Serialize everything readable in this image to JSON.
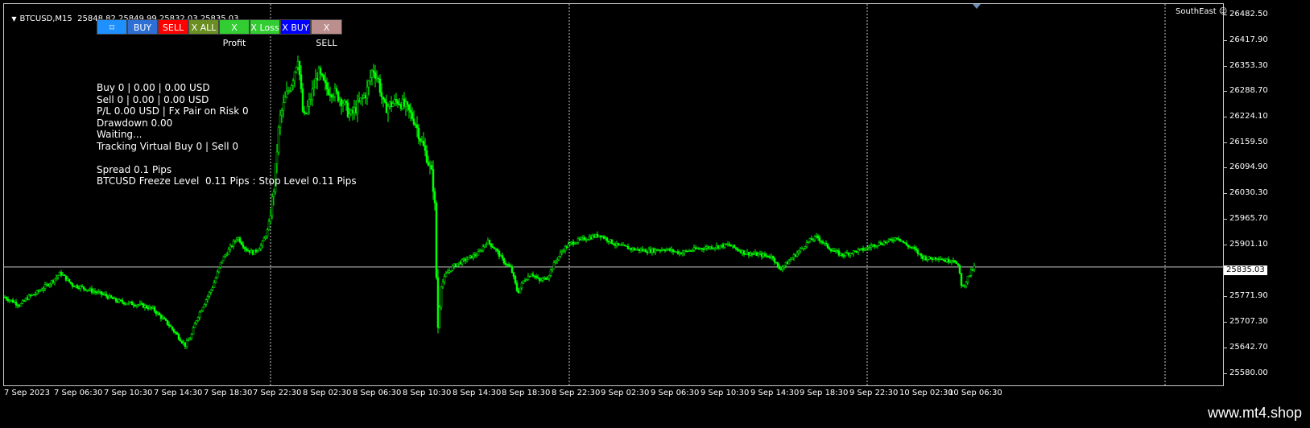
{
  "header": {
    "symbol_text": "BTCUSD,M15  25848.82 25849.99 25832.03 25835.03",
    "corner_label": "SouthEast",
    "corner_icon": "smiley-icon"
  },
  "toolbar": [
    {
      "label": "⌑",
      "color": "#1e90ff",
      "icon": "crosshair-icon"
    },
    {
      "label": "BUY",
      "color": "#2e6fd6"
    },
    {
      "label": "SELL",
      "color": "#ff0000"
    },
    {
      "label": "X ALL",
      "color": "#6b8e23"
    },
    {
      "label": "X Profit",
      "color": "#32cd32"
    },
    {
      "label": "X Loss",
      "color": "#32cd32"
    },
    {
      "label": "X BUY",
      "color": "#0000ff"
    },
    {
      "label": "X SELL",
      "color": "#bc8f8f"
    }
  ],
  "info_panel": {
    "line1": "Buy 0 | 0.00 | 0.00 USD",
    "line2": "Sell 0 | 0.00 | 0.00 USD",
    "line3": "P/L 0.00 USD | Fx Pair on Risk 0",
    "line4": "Drawdown 0.00",
    "line5": "Waiting...",
    "line6": "Tracking Virtual Buy 0 | Sell 0",
    "line7": "Spread 0.1 Pips",
    "line8": "BTCUSD Freeze Level  0.11 Pips : Stop Level 0.11 Pips"
  },
  "price_axis": {
    "labels": [
      "26482.50",
      "26417.90",
      "26353.30",
      "26288.70",
      "26224.10",
      "26159.50",
      "26094.90",
      "26030.30",
      "25965.70",
      "25901.10",
      "25835.03",
      "25771.90",
      "25707.30",
      "25642.70",
      "25580.00"
    ],
    "current_price": "25835.03"
  },
  "time_axis": {
    "labels": [
      "7 Sep 2023",
      "7 Sep 06:30",
      "7 Sep 10:30",
      "7 Sep 14:30",
      "7 Sep 18:30",
      "7 Sep 22:30",
      "8 Sep 02:30",
      "8 Sep 06:30",
      "8 Sep 10:30",
      "8 Sep 14:30",
      "8 Sep 18:30",
      "8 Sep 22:30",
      "9 Sep 02:30",
      "9 Sep 06:30",
      "9 Sep 10:30",
      "9 Sep 14:30",
      "9 Sep 18:30",
      "9 Sep 22:30",
      "10 Sep 02:30",
      "10 Sep 06:30"
    ]
  },
  "chart_data": {
    "type": "candlestick",
    "symbol": "BTCUSD",
    "timeframe": "M15",
    "ylim": [
      25580.0,
      26482.5
    ],
    "candle_color": "#00ff00",
    "background": "#000000",
    "grid": false,
    "current_price": 25835.03,
    "price_path": [
      [
        0,
        25760
      ],
      [
        10,
        25750
      ],
      [
        20,
        25740
      ],
      [
        30,
        25760
      ],
      [
        40,
        25770
      ],
      [
        50,
        25785
      ],
      [
        60,
        25800
      ],
      [
        70,
        25820
      ],
      [
        75,
        25810
      ],
      [
        85,
        25790
      ],
      [
        95,
        25785
      ],
      [
        110,
        25775
      ],
      [
        125,
        25765
      ],
      [
        140,
        25750
      ],
      [
        155,
        25745
      ],
      [
        170,
        25740
      ],
      [
        185,
        25730
      ],
      [
        195,
        25710
      ],
      [
        205,
        25690
      ],
      [
        215,
        25665
      ],
      [
        225,
        25640
      ],
      [
        232,
        25660
      ],
      [
        240,
        25710
      ],
      [
        250,
        25750
      ],
      [
        260,
        25790
      ],
      [
        270,
        25850
      ],
      [
        280,
        25880
      ],
      [
        290,
        25910
      ],
      [
        300,
        25880
      ],
      [
        310,
        25870
      ],
      [
        320,
        25890
      ],
      [
        328,
        25930
      ],
      [
        335,
        26030
      ],
      [
        342,
        26200
      ],
      [
        350,
        26260
      ],
      [
        358,
        26300
      ],
      [
        365,
        26360
      ],
      [
        372,
        26200
      ],
      [
        380,
        26250
      ],
      [
        390,
        26320
      ],
      [
        400,
        26280
      ],
      [
        410,
        26270
      ],
      [
        420,
        26250
      ],
      [
        430,
        26210
      ],
      [
        440,
        26240
      ],
      [
        450,
        26270
      ],
      [
        458,
        26330
      ],
      [
        465,
        26300
      ],
      [
        472,
        26230
      ],
      [
        480,
        26240
      ],
      [
        490,
        26250
      ],
      [
        500,
        26230
      ],
      [
        510,
        26200
      ],
      [
        518,
        26150
      ],
      [
        525,
        26110
      ],
      [
        532,
        26060
      ],
      [
        536,
        25960
      ],
      [
        538,
        25660
      ],
      [
        543,
        25790
      ],
      [
        550,
        25820
      ],
      [
        560,
        25840
      ],
      [
        570,
        25850
      ],
      [
        580,
        25860
      ],
      [
        590,
        25870
      ],
      [
        600,
        25900
      ],
      [
        610,
        25880
      ],
      [
        620,
        25850
      ],
      [
        630,
        25830
      ],
      [
        638,
        25770
      ],
      [
        645,
        25800
      ],
      [
        655,
        25820
      ],
      [
        665,
        25800
      ],
      [
        675,
        25810
      ],
      [
        685,
        25850
      ],
      [
        695,
        25880
      ],
      [
        705,
        25895
      ],
      [
        720,
        25905
      ],
      [
        740,
        25915
      ],
      [
        760,
        25890
      ],
      [
        780,
        25880
      ],
      [
        800,
        25875
      ],
      [
        820,
        25880
      ],
      [
        840,
        25870
      ],
      [
        860,
        25880
      ],
      [
        880,
        25885
      ],
      [
        900,
        25890
      ],
      [
        920,
        25870
      ],
      [
        940,
        25865
      ],
      [
        955,
        25860
      ],
      [
        962,
        25830
      ],
      [
        970,
        25840
      ],
      [
        980,
        25860
      ],
      [
        990,
        25880
      ],
      [
        1000,
        25900
      ],
      [
        1010,
        25910
      ],
      [
        1020,
        25890
      ],
      [
        1030,
        25875
      ],
      [
        1040,
        25865
      ],
      [
        1050,
        25870
      ],
      [
        1060,
        25875
      ],
      [
        1070,
        25880
      ],
      [
        1080,
        25890
      ],
      [
        1090,
        25895
      ],
      [
        1100,
        25900
      ],
      [
        1110,
        25910
      ],
      [
        1120,
        25890
      ],
      [
        1130,
        25880
      ],
      [
        1140,
        25860
      ],
      [
        1150,
        25855
      ],
      [
        1160,
        25860
      ],
      [
        1170,
        25850
      ],
      [
        1180,
        25855
      ],
      [
        1186,
        25830
      ],
      [
        1190,
        25780
      ],
      [
        1195,
        25800
      ],
      [
        1200,
        25820
      ],
      [
        1205,
        25835
      ]
    ]
  },
  "footer": {
    "brand": "www.mt4.shop"
  }
}
